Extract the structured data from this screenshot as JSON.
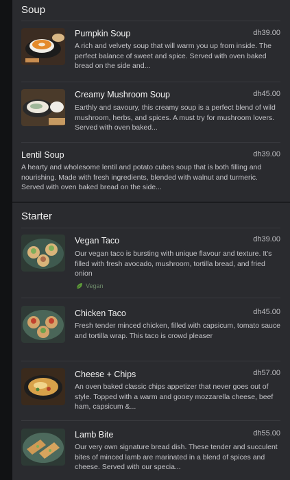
{
  "sections": [
    {
      "title": "Soup",
      "items": [
        {
          "name": "Pumpkin Soup",
          "price": "dh39.00",
          "description": "A rich and velvety soup that will warm you up from inside. The perfect balance of sweet and spice. Served with oven baked bread on the side and..."
        },
        {
          "name": "Creamy Mushroom Soup",
          "price": "dh45.00",
          "description": "Earthly and savoury, this creamy soup is a perfect blend of wild mushroom, herbs, and spices. A must try for mushroom lovers. Served with oven baked..."
        },
        {
          "name": "Lentil Soup",
          "price": "dh39.00",
          "description": "A hearty and wholesome lentil and potato cubes soup that is both filling and nourishing. Made with fresh ingredients, blended with walnut and turmeric. Served with oven baked bread on the side..."
        }
      ]
    },
    {
      "title": "Starter",
      "items": [
        {
          "name": "Vegan Taco",
          "price": "dh39.00",
          "description": "Our vegan taco is bursting with unique flavour and texture. It's filled with fresh avocado, mushroom, tortilla bread, and fried onion",
          "tag": "Vegan"
        },
        {
          "name": "Chicken Taco",
          "price": "dh45.00",
          "description": "Fresh tender minced chicken, filled with capsicum, tomato sauce and tortilla wrap. This taco is crowd pleaser"
        },
        {
          "name": "Cheese + Chips",
          "price": "dh57.00",
          "description": "An oven baked classic chips appetizer that never goes out of style. Topped with a warm and gooey mozzarella cheese, beef ham, capsicum &..."
        },
        {
          "name": "Lamb Bite",
          "price": "dh55.00",
          "description": "Our very own signature bread dish. These tender and succulent bites of minced lamb are marinated in a blend of spices and cheese. Served with our specia..."
        }
      ]
    }
  ]
}
